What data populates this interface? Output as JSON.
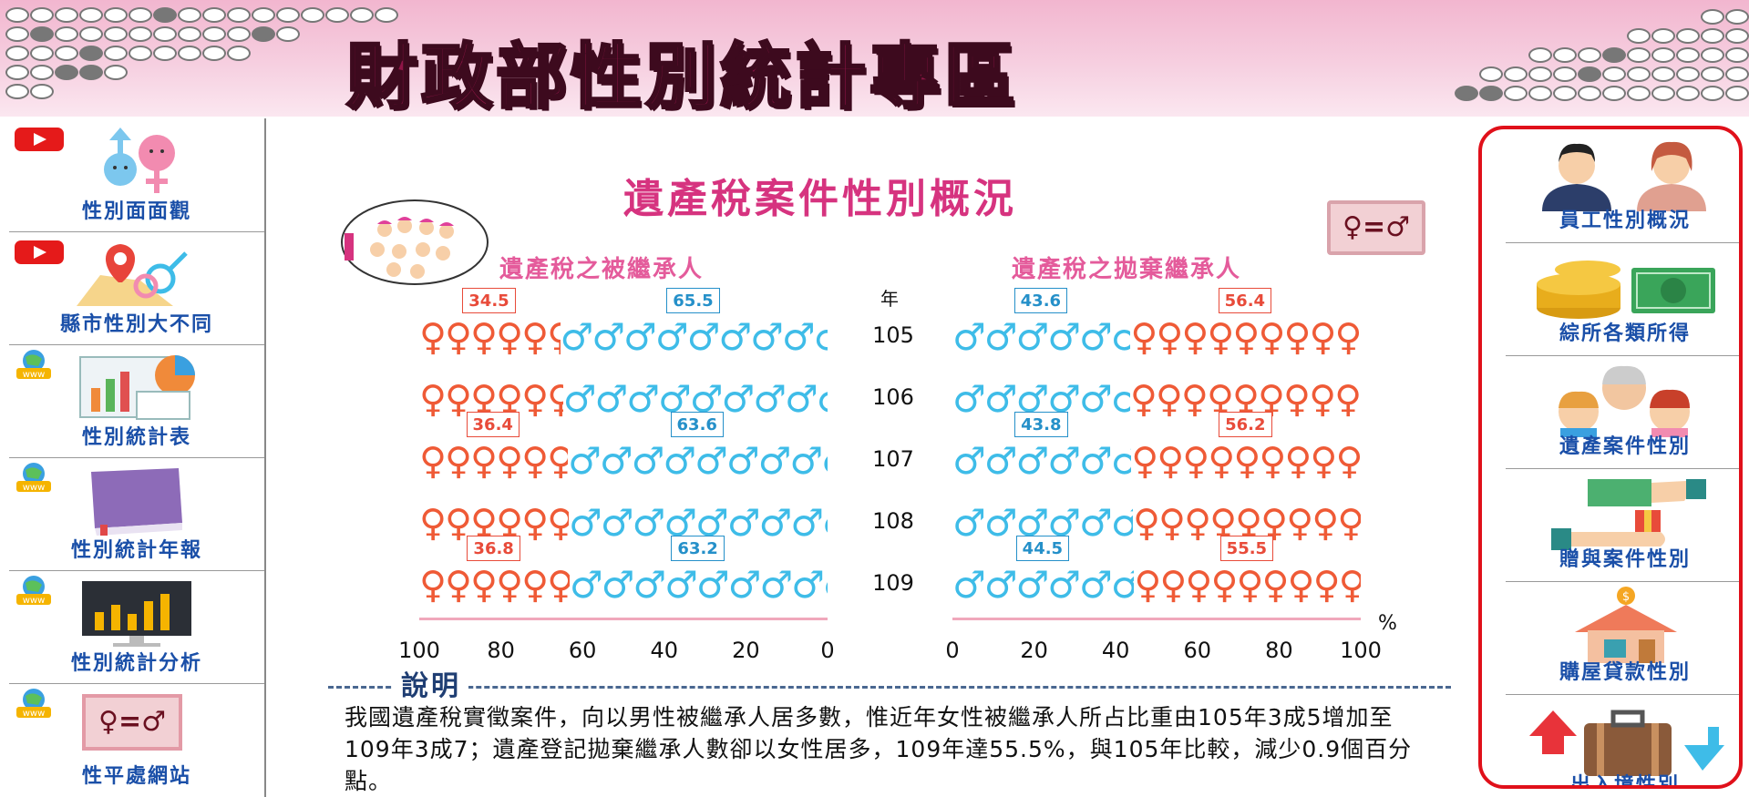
{
  "banner": {
    "title": "財政部性別統計專區"
  },
  "left_nav": [
    {
      "key": "gender-overview",
      "label": "性別面面觀",
      "badge": "youtube"
    },
    {
      "key": "county-gender",
      "label": "縣市性別大不同",
      "badge": "youtube"
    },
    {
      "key": "gender-stat-table",
      "label": "性別統計表",
      "badge": "www"
    },
    {
      "key": "gender-annual-report",
      "label": "性別統計年報",
      "badge": "www"
    },
    {
      "key": "gender-stat-analysis",
      "label": "性別統計分析",
      "badge": "www"
    },
    {
      "key": "gender-equality-site",
      "label": "性平處網站",
      "badge": "www",
      "symbol": "♀=♂"
    }
  ],
  "right_nav": [
    {
      "key": "staff-gender",
      "label": "員工性別概況"
    },
    {
      "key": "income-types",
      "label": "綜所各類所得"
    },
    {
      "key": "estate-gender",
      "label": "遺產案件性別"
    },
    {
      "key": "gift-gender",
      "label": "贈與案件性別"
    },
    {
      "key": "housing-loan-gender",
      "label": "購屋貸款性別"
    },
    {
      "key": "border-gender",
      "label": "出入境性別"
    }
  ],
  "main": {
    "title": "遺產稅案件性別概況",
    "equality_symbol": "♀=♂",
    "year_header": "年",
    "percent_sign": "%",
    "note_heading": "說明",
    "note_text": "我國遺產稅實徵案件，向以男性被繼承人居多數，惟近年女性被繼承人所占比重由105年3成5增加至109年3成7；遺產登記拋棄繼承人數卻以女性居多，109年達55.5%，與105年比較，減少0.9個百分點。"
  },
  "colors": {
    "female": "#ef5a36",
    "male": "#3ebce8",
    "title": "#d6337f",
    "nav_text": "#1a4fa8",
    "frame": "#e0101a"
  },
  "chart_data": [
    {
      "type": "bar",
      "title": "遺產稅之被繼承人",
      "categories": [
        "105",
        "106",
        "107",
        "108",
        "109"
      ],
      "series": [
        {
          "name": "♀",
          "values": [
            34.5,
            35.2,
            36.4,
            36.6,
            36.8
          ]
        },
        {
          "name": "♂",
          "values": [
            65.5,
            64.8,
            63.6,
            63.4,
            63.2
          ]
        }
      ],
      "xlim": [
        100,
        0
      ],
      "ticks": [
        "100",
        "80",
        "60",
        "40",
        "20",
        "0"
      ],
      "labeled_years": [
        "105",
        "107",
        "109"
      ]
    },
    {
      "type": "bar",
      "title": "遺產稅之拋棄繼承人",
      "categories": [
        "105",
        "106",
        "107",
        "108",
        "109"
      ],
      "series": [
        {
          "name": "♂",
          "values": [
            43.6,
            43.5,
            43.8,
            44.2,
            44.5
          ]
        },
        {
          "name": "♀",
          "values": [
            56.4,
            56.5,
            56.2,
            55.8,
            55.5
          ]
        }
      ],
      "xlim": [
        0,
        100
      ],
      "ticks": [
        "0",
        "20",
        "40",
        "60",
        "80",
        "100"
      ],
      "labeled_years": [
        "105",
        "107",
        "109"
      ]
    }
  ]
}
